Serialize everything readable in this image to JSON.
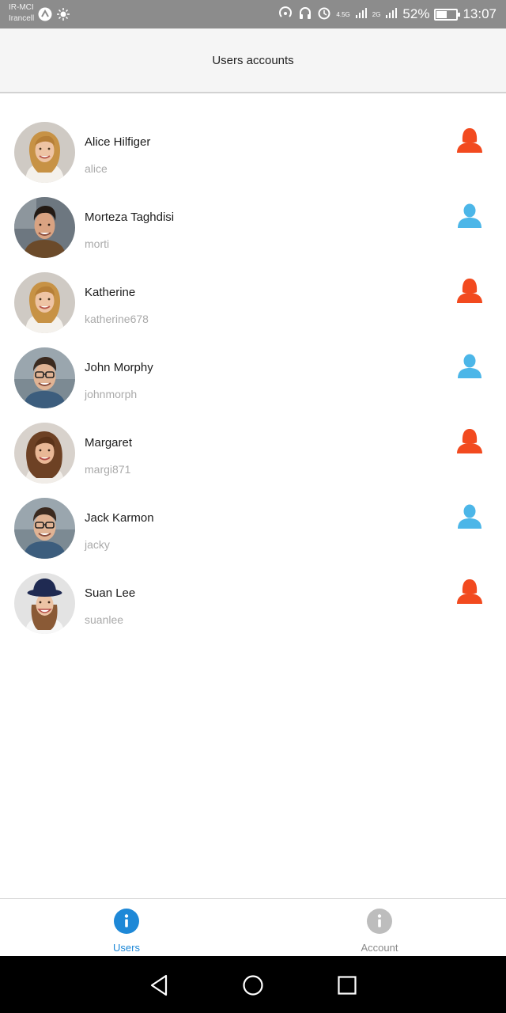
{
  "status_bar": {
    "carrier_line1": "IR-MCI",
    "carrier_line2": "Irancell",
    "network_a": "4.5G",
    "network_b": "2G",
    "battery": "52%",
    "battery_level": 0.52,
    "time": "13:07"
  },
  "header": {
    "title": "Users accounts"
  },
  "colors": {
    "female": "#f24a1f",
    "male": "#4cb6e8",
    "active_tab": "#1e88d7",
    "inactive_tab": "#bdbdbd"
  },
  "users": [
    {
      "name": "Alice Hilfiger",
      "username": "alice",
      "gender": "female",
      "avatar": "blonde-woman-avatar"
    },
    {
      "name": "Morteza Taghdisi",
      "username": "morti",
      "gender": "male",
      "avatar": "dark-hair-man-avatar"
    },
    {
      "name": "Katherine",
      "username": "katherine678",
      "gender": "female",
      "avatar": "blonde-woman-avatar"
    },
    {
      "name": "John Morphy",
      "username": "johnmorph",
      "gender": "male",
      "avatar": "glasses-man-avatar"
    },
    {
      "name": "Margaret",
      "username": "margi871",
      "gender": "female",
      "avatar": "brunette-woman-avatar"
    },
    {
      "name": "Jack Karmon",
      "username": "jacky",
      "gender": "male",
      "avatar": "glasses-man-avatar"
    },
    {
      "name": "Suan Lee",
      "username": "suanlee",
      "gender": "female",
      "avatar": "hat-woman-avatar"
    }
  ],
  "bottom_nav": {
    "tabs": [
      {
        "label": "Users",
        "icon": "info-icon",
        "active": true
      },
      {
        "label": "Account",
        "icon": "info-icon",
        "active": false
      }
    ]
  },
  "system_nav": {
    "buttons": [
      "back-icon",
      "home-icon",
      "recents-icon"
    ]
  }
}
